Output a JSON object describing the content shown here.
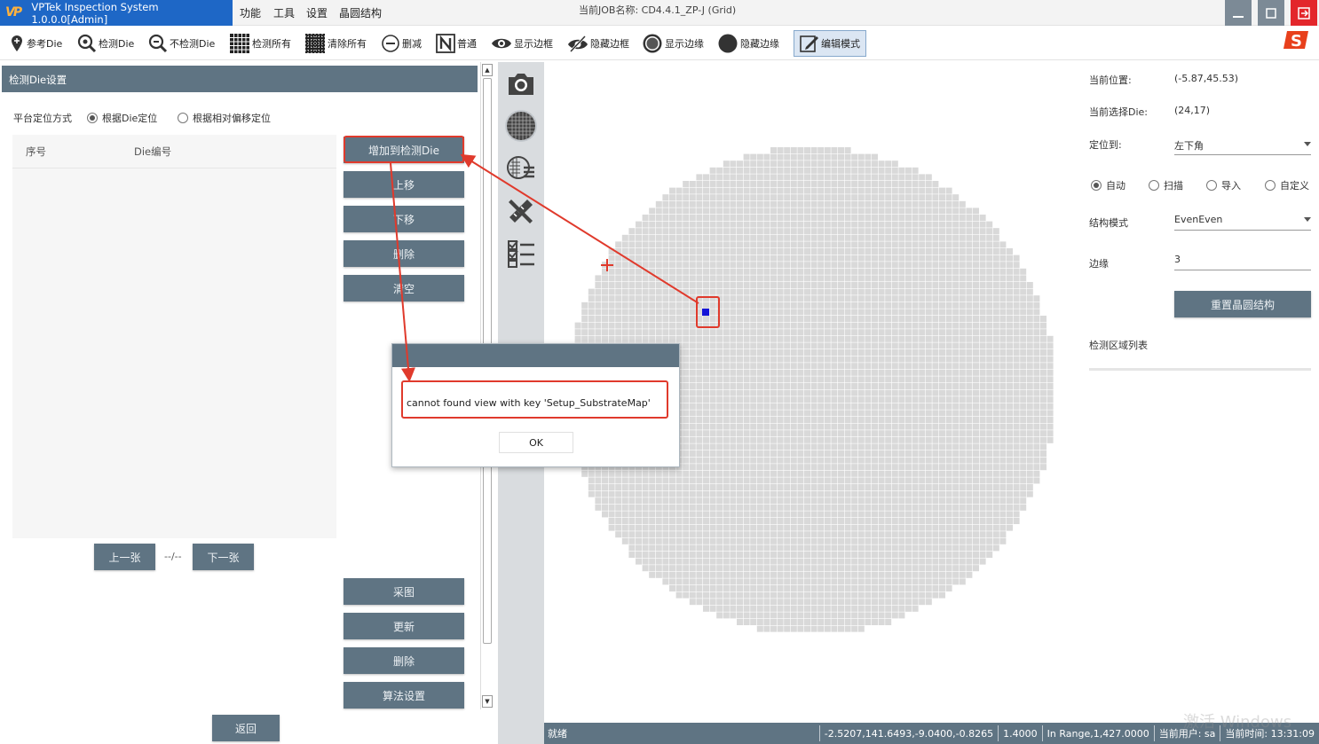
{
  "titlebar": {
    "app_name": "VPTek Inspection System 1.0.0.0[Admin]",
    "menus": [
      "功能",
      "工具",
      "设置",
      "晶圆结构"
    ],
    "job_title": "当前JOB名称:  CD4.4.1_ZP-J (Grid)"
  },
  "toolbar": {
    "items": [
      "参考Die",
      "检测Die",
      "不检测Die",
      "检测所有",
      "清除所有",
      "删减",
      "普通",
      "显示边框",
      "隐藏边框",
      "显示边缘",
      "隐藏边缘",
      "编辑模式"
    ]
  },
  "left_panel": {
    "title": "检测Die设置",
    "positioning_label": "平台定位方式",
    "radio_die": "根据Die定位",
    "radio_offset": "根据相对偏移定位",
    "col_index": "序号",
    "col_die": "Die编号",
    "btn_add": "增加到检测Die",
    "btn_up": "上移",
    "btn_down": "下移",
    "btn_delete": "删除",
    "btn_clear": "清空",
    "btn_prev": "上一张",
    "page_indicator": "--/--",
    "btn_next": "下一张",
    "btn_capture": "采图",
    "btn_update": "更新",
    "btn_delete2": "删除",
    "btn_algo": "算法设置",
    "btn_back": "返回"
  },
  "right_panel": {
    "current_pos_label": "当前位置:",
    "current_pos_value": "(-5.87,45.53)",
    "current_die_label": "当前选择Die:",
    "current_die_value": "(24,17)",
    "locate_label": "定位到:",
    "locate_value": "左下角",
    "modes": [
      "自动",
      "扫描",
      "导入",
      "自定义"
    ],
    "struct_label": "结构模式",
    "struct_value": "EvenEven",
    "edge_label": "边缘",
    "edge_value": "3",
    "reset_btn": "重置晶圆结构",
    "region_list_label": "检测区域列表"
  },
  "dialog": {
    "message": "cannot found view with key 'Setup_SubstrateMap'",
    "ok": "OK"
  },
  "status": {
    "state": "就绪",
    "coords": "-2.5207,141.6493,-9.0400,-0.8265",
    "zoom": "1.4000",
    "range": "In Range,1,427.0000",
    "user": "当前用户:  sa",
    "time": "当前时间:  13:31:09"
  },
  "watermark": "激活 Windows",
  "colors": {
    "accent": "#5f7483",
    "title_blue": "#1e67c6",
    "highlight_red": "#e03a2c",
    "selected_die": "#1414d8",
    "wafer_die": "#d9d9d9"
  }
}
